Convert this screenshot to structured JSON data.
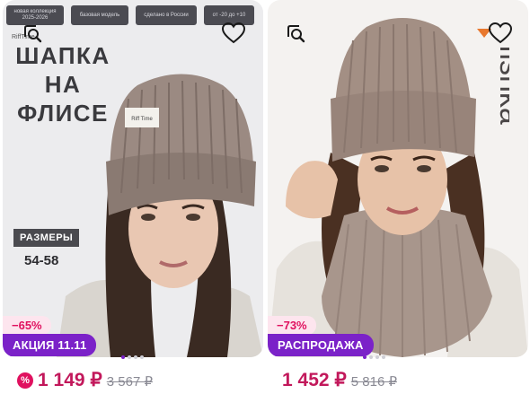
{
  "products": [
    {
      "banner_chips": [
        "новая коллекция 2025-2026",
        "базовая модель",
        "сделано в России",
        "от -20 до +10"
      ],
      "promo_title": [
        "ШАПКА",
        "НА",
        "ФЛИСЕ"
      ],
      "brand_small": "RiffTime",
      "hat_label": "Riff Time",
      "sizes_label": "РАЗМЕРЫ",
      "sizes_value": "54-58",
      "discount": "−65%",
      "promo_badge": "АКЦИЯ 11.11",
      "price": "1 149 ₽",
      "old_price": "3 567 ₽",
      "price_badge_icon": "percent-icon",
      "dots_count": 4
    },
    {
      "brand_logo": "fishka",
      "discount": "−73%",
      "promo_badge": "РАСПРОДАЖА",
      "price": "1 452 ₽",
      "old_price": "5 816 ₽",
      "dots_count": 4
    }
  ],
  "icons": {
    "similar": "similar-search-icon",
    "favorite": "heart-icon"
  },
  "colors": {
    "accent": "#7b22c8",
    "price": "#c2185b",
    "discount": "#e0115f"
  }
}
